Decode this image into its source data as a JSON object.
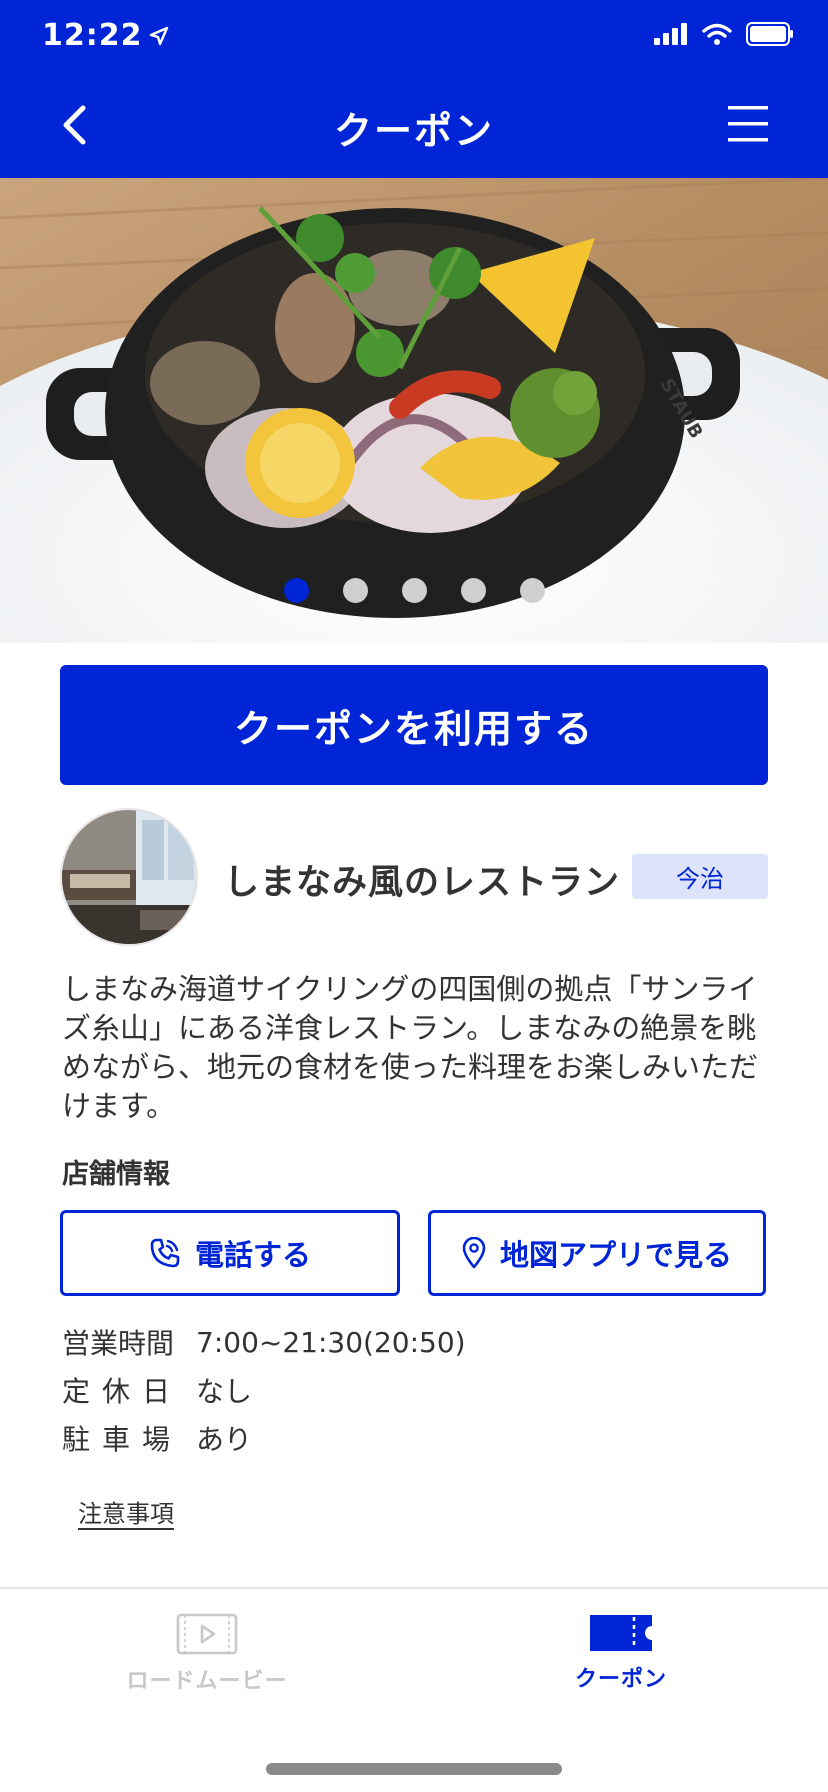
{
  "status_bar": {
    "time": "12:22",
    "icons": [
      "location-arrow-icon",
      "signal-icon",
      "wifi-icon",
      "battery-icon"
    ]
  },
  "header": {
    "title": "クーポン",
    "back_icon": "chevron-left-icon",
    "menu_icon": "hamburger-menu-icon"
  },
  "carousel": {
    "image": "food-photo-acqua-pazza-in-black-pot",
    "page_count": 5,
    "active_page": 1
  },
  "use_button": {
    "label": "クーポンを利用する"
  },
  "shop": {
    "name": "しまなみ風のレストラン",
    "area": "今治",
    "description": "しまなみ海道サイクリングの四国側の拠点「サンライズ糸山」にある洋食レストラン。しまなみの絶景を眺めながら、地元の食材を使った料理をお楽しみいただけます。"
  },
  "store_info": {
    "title": "店舗情報",
    "call_label": "電話する",
    "map_label": "地図アプリで見る",
    "rows": [
      {
        "label": "営業時間",
        "value": "7:00~21:30(20:50)"
      },
      {
        "label": "定休日",
        "value": "なし"
      },
      {
        "label": "駐車場",
        "value": "あり"
      }
    ],
    "notice_label": "注意事項"
  },
  "tabs": [
    {
      "label": "ロードムービー",
      "icon": "play-video-icon",
      "active": false
    },
    {
      "label": "クーポン",
      "icon": "ticket-icon",
      "active": true
    }
  ],
  "colors": {
    "brand": "#0025d7",
    "badge_bg": "#dde3fb",
    "inactive_tab": "#c8c8c8"
  }
}
